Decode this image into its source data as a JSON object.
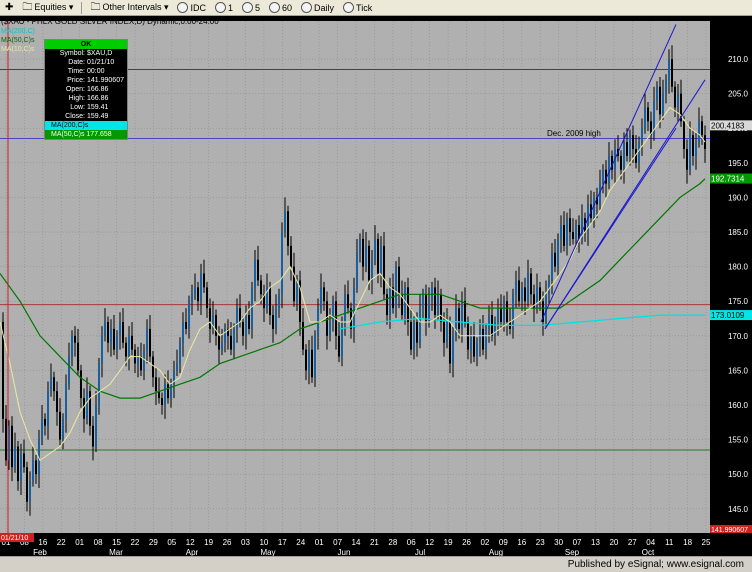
{
  "toolbar": {
    "items": [
      {
        "label": "Equities ▾",
        "icon": "folder-icon"
      },
      {
        "label": "Other Intervals ▾",
        "icon": "folder-icon"
      },
      {
        "label": "IDC"
      },
      {
        "label": "1"
      },
      {
        "label": "5"
      },
      {
        "label": "60"
      },
      {
        "label": "Daily"
      },
      {
        "label": "Tick"
      }
    ]
  },
  "chart_header": {
    "title": "($XAU - PHLX GOLD SILVER INDEX,D) Dynamic,0:00-24:00",
    "legend_ma1": "MA(200,C)",
    "legend_ma2": "MA(50,C)s",
    "legend_ma3": "MA(10,C)s"
  },
  "data_window": {
    "status": "OK",
    "rows": [
      {
        "label": "Symbol:",
        "value": "$XAU,D"
      },
      {
        "label": "Date:",
        "value": "01/21/10"
      },
      {
        "label": "Time:",
        "value": "00:00"
      },
      {
        "label": "Price:",
        "value": "141.990607"
      },
      {
        "label": "Open:",
        "value": "166.86"
      },
      {
        "label": "High:",
        "value": "166.86"
      },
      {
        "label": "Low:",
        "value": "159.41"
      },
      {
        "label": "Close:",
        "value": "159.49"
      }
    ],
    "ma10_label": "MA(200,C)s",
    "ma50_label": "MA(50,C)s 177.658"
  },
  "annotation": "Dec. 2009 high",
  "price_tags": {
    "cyan_tag": "173.0109",
    "green_tag": "192.7314",
    "gray_tag": "200.4183",
    "current_tag": "141.990607",
    "date_tag": "01/21/10"
  },
  "footer": {
    "text": "Published by eSignal; www.esignal.com"
  },
  "chart_data": {
    "type": "candlestick",
    "title": "($XAU - PHLX GOLD SILVER INDEX,D) Dynamic,0:00-24:00",
    "y_ticks": [
      145.0,
      150.0,
      155.0,
      160.0,
      165.0,
      170.0,
      175.0,
      180.0,
      185.0,
      190.0,
      195.0,
      200.0,
      205.0,
      210.0
    ],
    "ylim": [
      141.5,
      215.5
    ],
    "month_labels": [
      "Feb",
      "Mar",
      "Apr",
      "May",
      "Jun",
      "Jul",
      "Aug",
      "Sep",
      "Oct"
    ],
    "x_tick_labels": [
      "01",
      "08",
      "16",
      "22",
      "01",
      "08",
      "15",
      "22",
      "29",
      "05",
      "12",
      "19",
      "26",
      "03",
      "10",
      "17",
      "24",
      "01",
      "07",
      "14",
      "21",
      "28",
      "06",
      "12",
      "19",
      "26",
      "02",
      "09",
      "16",
      "23",
      "30",
      "07",
      "13",
      "20",
      "27",
      "04",
      "11",
      "18",
      "25"
    ],
    "horizontal_lines": [
      {
        "name": "Dec. 2009 high",
        "value": 198.5,
        "color": "#2222cc"
      },
      {
        "value": 208.5,
        "color": "#333333"
      },
      {
        "value": 174.5,
        "color": "#aa2222"
      },
      {
        "value": 153.5,
        "color": "#006600"
      }
    ],
    "close_path": [
      [
        0,
        172
      ],
      [
        3,
        158
      ],
      [
        6,
        152
      ],
      [
        9,
        157
      ],
      [
        12,
        151
      ],
      [
        15,
        154
      ],
      [
        18,
        149
      ],
      [
        21,
        153
      ],
      [
        24,
        151
      ],
      [
        27,
        146
      ],
      [
        30,
        149
      ],
      [
        33,
        152
      ],
      [
        36,
        150
      ],
      [
        39,
        155
      ],
      [
        42,
        158
      ],
      [
        45,
        157
      ],
      [
        48,
        162
      ],
      [
        51,
        164
      ],
      [
        54,
        162
      ],
      [
        57,
        159
      ],
      [
        60,
        155
      ],
      [
        63,
        158
      ],
      [
        66,
        163
      ],
      [
        69,
        167
      ],
      [
        72,
        170
      ],
      [
        75,
        169
      ],
      [
        78,
        165
      ],
      [
        81,
        161
      ],
      [
        84,
        158
      ],
      [
        87,
        162
      ],
      [
        90,
        157
      ],
      [
        93,
        154
      ],
      [
        96,
        160
      ],
      [
        99,
        166
      ],
      [
        102,
        170
      ],
      [
        105,
        172
      ],
      [
        108,
        169
      ],
      [
        111,
        171
      ],
      [
        114,
        168
      ],
      [
        117,
        170
      ],
      [
        120,
        172
      ],
      [
        123,
        169
      ],
      [
        126,
        167
      ],
      [
        129,
        170
      ],
      [
        132,
        168
      ],
      [
        135,
        166
      ],
      [
        138,
        167
      ],
      [
        141,
        165
      ],
      [
        144,
        168
      ],
      [
        147,
        171
      ],
      [
        150,
        167
      ],
      [
        153,
        164
      ],
      [
        156,
        162
      ],
      [
        159,
        161
      ],
      [
        162,
        160
      ],
      [
        165,
        163
      ],
      [
        168,
        161
      ],
      [
        171,
        163
      ],
      [
        174,
        165
      ],
      [
        177,
        166
      ],
      [
        180,
        169
      ],
      [
        183,
        172
      ],
      [
        186,
        171
      ],
      [
        189,
        175
      ],
      [
        192,
        176
      ],
      [
        195,
        177
      ],
      [
        198,
        175
      ],
      [
        201,
        179
      ],
      [
        204,
        177
      ],
      [
        207,
        174
      ],
      [
        210,
        171
      ],
      [
        213,
        173
      ],
      [
        216,
        170
      ],
      [
        219,
        168
      ],
      [
        222,
        169
      ],
      [
        225,
        171
      ],
      [
        228,
        170
      ],
      [
        231,
        168
      ],
      [
        234,
        171
      ],
      [
        237,
        174
      ],
      [
        240,
        172
      ],
      [
        243,
        170
      ],
      [
        246,
        173
      ],
      [
        249,
        171
      ],
      [
        252,
        177
      ],
      [
        255,
        181
      ],
      [
        258,
        178
      ],
      [
        261,
        176
      ],
      [
        264,
        174
      ],
      [
        267,
        177
      ],
      [
        270,
        173
      ],
      [
        273,
        171
      ],
      [
        276,
        174
      ],
      [
        279,
        176
      ],
      [
        282,
        185
      ],
      [
        285,
        188
      ],
      [
        288,
        183
      ],
      [
        291,
        180
      ],
      [
        294,
        175
      ],
      [
        297,
        178
      ],
      [
        300,
        172
      ],
      [
        303,
        168
      ],
      [
        306,
        165
      ],
      [
        309,
        168
      ],
      [
        312,
        164
      ],
      [
        315,
        170
      ],
      [
        318,
        174
      ],
      [
        321,
        177
      ],
      [
        324,
        175
      ],
      [
        327,
        170
      ],
      [
        330,
        172
      ],
      [
        333,
        175
      ],
      [
        336,
        170
      ],
      [
        339,
        167
      ],
      [
        342,
        172
      ],
      [
        345,
        176
      ],
      [
        348,
        174
      ],
      [
        351,
        171
      ],
      [
        354,
        177
      ],
      [
        357,
        182
      ],
      [
        360,
        184
      ],
      [
        363,
        180
      ],
      [
        366,
        183
      ],
      [
        369,
        178
      ],
      [
        372,
        181
      ],
      [
        375,
        184
      ],
      [
        378,
        179
      ],
      [
        381,
        183
      ],
      [
        384,
        176
      ],
      [
        387,
        173
      ],
      [
        390,
        177
      ],
      [
        393,
        174
      ],
      [
        396,
        180
      ],
      [
        399,
        176
      ],
      [
        402,
        173
      ],
      [
        405,
        177
      ],
      [
        408,
        172
      ],
      [
        411,
        168
      ],
      [
        414,
        172
      ],
      [
        417,
        169
      ],
      [
        420,
        174
      ],
      [
        423,
        176
      ],
      [
        426,
        172
      ],
      [
        429,
        175
      ],
      [
        432,
        177
      ],
      [
        435,
        173
      ],
      [
        438,
        176
      ],
      [
        441,
        172
      ],
      [
        444,
        169
      ],
      [
        447,
        172
      ],
      [
        450,
        166
      ],
      [
        453,
        170
      ],
      [
        456,
        174
      ],
      [
        459,
        171
      ],
      [
        462,
        175
      ],
      [
        465,
        172
      ],
      [
        468,
        168
      ],
      [
        471,
        170
      ],
      [
        474,
        167
      ],
      [
        477,
        169
      ],
      [
        480,
        171
      ],
      [
        483,
        168
      ],
      [
        486,
        171
      ],
      [
        489,
        173
      ],
      [
        492,
        170
      ],
      [
        495,
        172
      ],
      [
        498,
        174
      ],
      [
        501,
        172
      ],
      [
        504,
        175
      ],
      [
        507,
        172
      ],
      [
        510,
        171
      ],
      [
        513,
        176
      ],
      [
        516,
        178
      ],
      [
        519,
        175
      ],
      [
        522,
        177
      ],
      [
        525,
        175
      ],
      [
        528,
        179
      ],
      [
        531,
        176
      ],
      [
        534,
        174
      ],
      [
        537,
        177
      ],
      [
        540,
        175
      ],
      [
        543,
        172
      ],
      [
        546,
        176
      ],
      [
        549,
        178
      ],
      [
        552,
        182
      ],
      [
        555,
        180
      ],
      [
        558,
        184
      ],
      [
        561,
        186
      ],
      [
        564,
        183
      ],
      [
        567,
        187
      ],
      [
        570,
        185
      ],
      [
        573,
        184
      ],
      [
        576,
        186
      ],
      [
        579,
        184
      ],
      [
        582,
        187
      ],
      [
        585,
        185
      ],
      [
        588,
        189
      ],
      [
        591,
        187
      ],
      [
        594,
        190
      ],
      [
        597,
        189
      ],
      [
        600,
        192
      ],
      [
        603,
        194
      ],
      [
        606,
        192
      ],
      [
        609,
        196
      ],
      [
        612,
        194
      ],
      [
        615,
        197
      ],
      [
        618,
        196
      ],
      [
        621,
        194
      ],
      [
        624,
        198
      ],
      [
        627,
        196
      ],
      [
        630,
        199
      ],
      [
        633,
        197
      ],
      [
        636,
        195
      ],
      [
        639,
        198
      ],
      [
        642,
        200
      ],
      [
        645,
        203
      ],
      [
        648,
        201
      ],
      [
        651,
        199
      ],
      [
        654,
        204
      ],
      [
        657,
        206
      ],
      [
        660,
        202
      ],
      [
        663,
        205
      ],
      [
        666,
        207
      ],
      [
        669,
        210
      ],
      [
        672,
        206
      ],
      [
        675,
        203
      ],
      [
        678,
        205
      ],
      [
        681,
        201
      ],
      [
        684,
        197
      ],
      [
        687,
        194
      ],
      [
        690,
        199
      ],
      [
        693,
        196
      ],
      [
        696,
        198
      ],
      [
        699,
        201
      ],
      [
        702,
        199
      ],
      [
        705,
        197
      ]
    ],
    "ma10_path": [
      [
        0,
        172
      ],
      [
        10,
        166
      ],
      [
        20,
        159
      ],
      [
        30,
        155
      ],
      [
        40,
        152
      ],
      [
        50,
        153
      ],
      [
        60,
        154
      ],
      [
        70,
        156
      ],
      [
        80,
        159
      ],
      [
        90,
        161
      ],
      [
        100,
        162
      ],
      [
        110,
        163
      ],
      [
        120,
        165
      ],
      [
        130,
        167
      ],
      [
        140,
        167
      ],
      [
        150,
        166
      ],
      [
        160,
        165
      ],
      [
        170,
        163
      ],
      [
        180,
        164
      ],
      [
        190,
        168
      ],
      [
        200,
        171
      ],
      [
        210,
        172
      ],
      [
        220,
        170
      ],
      [
        230,
        171
      ],
      [
        240,
        172
      ],
      [
        250,
        174
      ],
      [
        260,
        175
      ],
      [
        270,
        177
      ],
      [
        280,
        178
      ],
      [
        290,
        180
      ],
      [
        300,
        177
      ],
      [
        310,
        172
      ],
      [
        320,
        172
      ],
      [
        330,
        173
      ],
      [
        340,
        172
      ],
      [
        350,
        172
      ],
      [
        360,
        175
      ],
      [
        370,
        178
      ],
      [
        380,
        179
      ],
      [
        390,
        177
      ],
      [
        400,
        176
      ],
      [
        410,
        174
      ],
      [
        420,
        172
      ],
      [
        430,
        172
      ],
      [
        440,
        173
      ],
      [
        450,
        172
      ],
      [
        460,
        170
      ],
      [
        470,
        170
      ],
      [
        480,
        170
      ],
      [
        490,
        170
      ],
      [
        500,
        171
      ],
      [
        510,
        172
      ],
      [
        520,
        173
      ],
      [
        530,
        174
      ],
      [
        540,
        175
      ],
      [
        550,
        177
      ],
      [
        560,
        179
      ],
      [
        570,
        181
      ],
      [
        580,
        184
      ],
      [
        590,
        186
      ],
      [
        600,
        188
      ],
      [
        610,
        191
      ],
      [
        620,
        193
      ],
      [
        630,
        195
      ],
      [
        640,
        197
      ],
      [
        650,
        199
      ],
      [
        660,
        201
      ],
      [
        670,
        203
      ],
      [
        680,
        202
      ],
      [
        690,
        200
      ],
      [
        700,
        199
      ],
      [
        705,
        198
      ]
    ],
    "ma50_path": [
      [
        0,
        179
      ],
      [
        20,
        175
      ],
      [
        40,
        170
      ],
      [
        60,
        167
      ],
      [
        80,
        164
      ],
      [
        100,
        162
      ],
      [
        120,
        161
      ],
      [
        140,
        161
      ],
      [
        160,
        162
      ],
      [
        180,
        163
      ],
      [
        200,
        164
      ],
      [
        220,
        166
      ],
      [
        240,
        167
      ],
      [
        260,
        168
      ],
      [
        280,
        169
      ],
      [
        300,
        171
      ],
      [
        320,
        172
      ],
      [
        340,
        173
      ],
      [
        360,
        174
      ],
      [
        380,
        175
      ],
      [
        400,
        176
      ],
      [
        420,
        176
      ],
      [
        440,
        176
      ],
      [
        460,
        175
      ],
      [
        480,
        174
      ],
      [
        500,
        174
      ],
      [
        520,
        174
      ],
      [
        540,
        174
      ],
      [
        560,
        174
      ],
      [
        580,
        176
      ],
      [
        600,
        178
      ],
      [
        620,
        181
      ],
      [
        640,
        184
      ],
      [
        660,
        187
      ],
      [
        680,
        190
      ],
      [
        700,
        192
      ],
      [
        705,
        192.7
      ]
    ],
    "ma200_path": [
      [
        340,
        171
      ],
      [
        380,
        172
      ],
      [
        420,
        172.5
      ],
      [
        460,
        172
      ],
      [
        500,
        171.5
      ],
      [
        540,
        171.5
      ],
      [
        580,
        172
      ],
      [
        620,
        172.5
      ],
      [
        660,
        173
      ],
      [
        700,
        173
      ],
      [
        705,
        173.0
      ]
    ],
    "channel_lines": [
      {
        "from": [
          541,
          172
        ],
        "to": [
          676,
          215
        ]
      },
      {
        "from": [
          545,
          171
        ],
        "to": [
          705,
          207
        ]
      },
      {
        "from": [
          545,
          171
        ],
        "to": [
          676,
          200
        ]
      }
    ]
  }
}
